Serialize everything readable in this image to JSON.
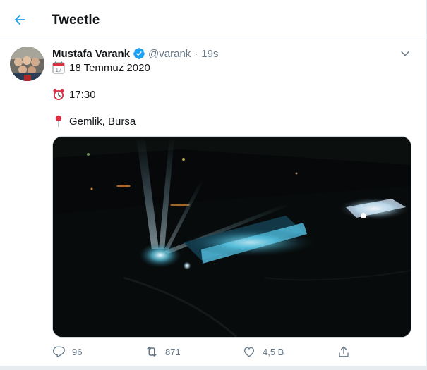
{
  "header": {
    "title": "Tweetle",
    "back_icon": "arrow-left-icon"
  },
  "tweet": {
    "author_name": "Mustafa Varank",
    "verified": true,
    "handle": "@varank",
    "separator": "·",
    "time": "19s",
    "lines": {
      "date": "18 Temmuz 2020",
      "clock": "17:30",
      "location": "Gemlik, Bursa"
    },
    "line_icons": {
      "date": "calendar-icon",
      "clock": "alarm-clock-icon",
      "location": "pushpin-icon"
    }
  },
  "actions": {
    "reply_count": "96",
    "retweet_count": "871",
    "like_count": "4,5 B",
    "share_icon": "share-icon"
  },
  "colors": {
    "accent": "#1da1f2",
    "muted": "#657786",
    "border": "#e6ecf0"
  }
}
